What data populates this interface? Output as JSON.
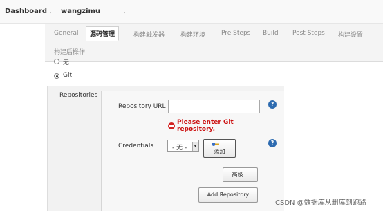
{
  "breadcrumb": {
    "items": [
      "Dashboard",
      "wangzimu"
    ],
    "separator": "›"
  },
  "tabs": [
    {
      "label": "General",
      "active": false
    },
    {
      "label": "源码管理",
      "active": true
    },
    {
      "label": "构建触发器",
      "active": false
    },
    {
      "label": "构建环境",
      "active": false
    },
    {
      "label": "Pre Steps",
      "active": false
    },
    {
      "label": "Build",
      "active": false
    },
    {
      "label": "Post Steps",
      "active": false
    },
    {
      "label": "构建设置",
      "active": false
    },
    {
      "label": "构建后操作",
      "active": false
    }
  ],
  "scm": {
    "options": [
      {
        "label": "无",
        "checked": false
      },
      {
        "label": "Git",
        "checked": true
      }
    ],
    "repositories_label": "Repositories",
    "repository_url": {
      "label": "Repository URL",
      "value": "",
      "error": "Please enter Git repository.",
      "help": "?"
    },
    "credentials": {
      "label": "Credentials",
      "selected": "- 无 -",
      "add_label": "添加",
      "help": "?"
    },
    "advanced_label": "高级...",
    "add_repository_label": "Add Repository"
  },
  "watermark": "CSDN @数据库从删库到跑路",
  "colors": {
    "error": "#cc1111",
    "help": "#2d6bb0",
    "active_tab_bg": "#ffffff"
  }
}
